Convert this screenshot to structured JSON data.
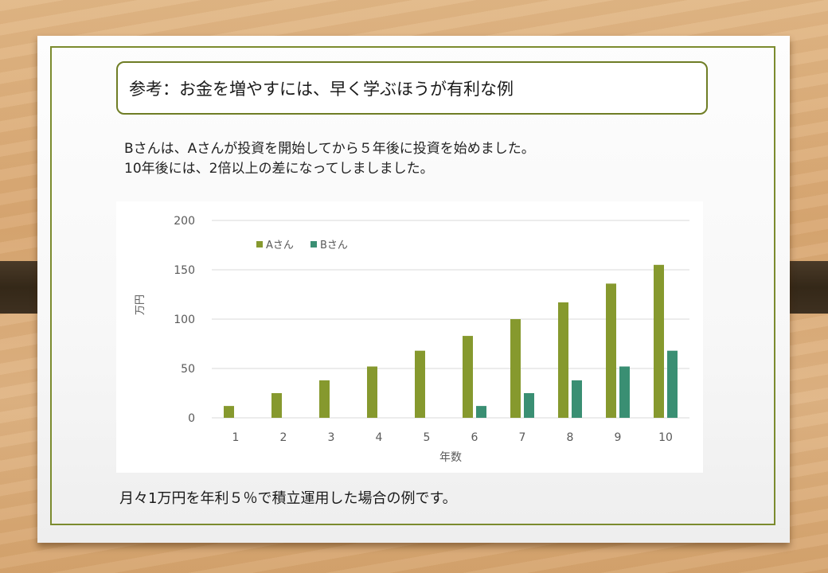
{
  "title": "参考：お金を増やすには、早く学ぶほうが有利な例",
  "description": {
    "line1": "Bさんは、Aさんが投資を開始してから５年後に投資を始めました。",
    "line2": "10年後には、2倍以上の差になってしましました。"
  },
  "footnote": "月々1万円を年利５％で積立運用した場合の例です。",
  "colors": {
    "series_a": "#86992e",
    "series_b": "#3a8f73",
    "frame": "#7b8b2e",
    "gridline": "#d9d9d9",
    "axis_text": "#595959"
  },
  "chart_data": {
    "type": "bar",
    "categories": [
      "1",
      "2",
      "3",
      "4",
      "5",
      "6",
      "7",
      "8",
      "9",
      "10"
    ],
    "series": [
      {
        "name": "Aさん",
        "values": [
          12,
          25,
          38,
          52,
          68,
          83,
          100,
          117,
          136,
          155
        ]
      },
      {
        "name": "Bさん",
        "values": [
          0,
          0,
          0,
          0,
          0,
          12,
          25,
          38,
          52,
          68
        ]
      }
    ],
    "xlabel": "年数",
    "ylabel": "万円",
    "ylim": [
      0,
      200
    ],
    "yticks": [
      0,
      50,
      100,
      150,
      200
    ],
    "grid": true,
    "legend_position": "top-left"
  }
}
